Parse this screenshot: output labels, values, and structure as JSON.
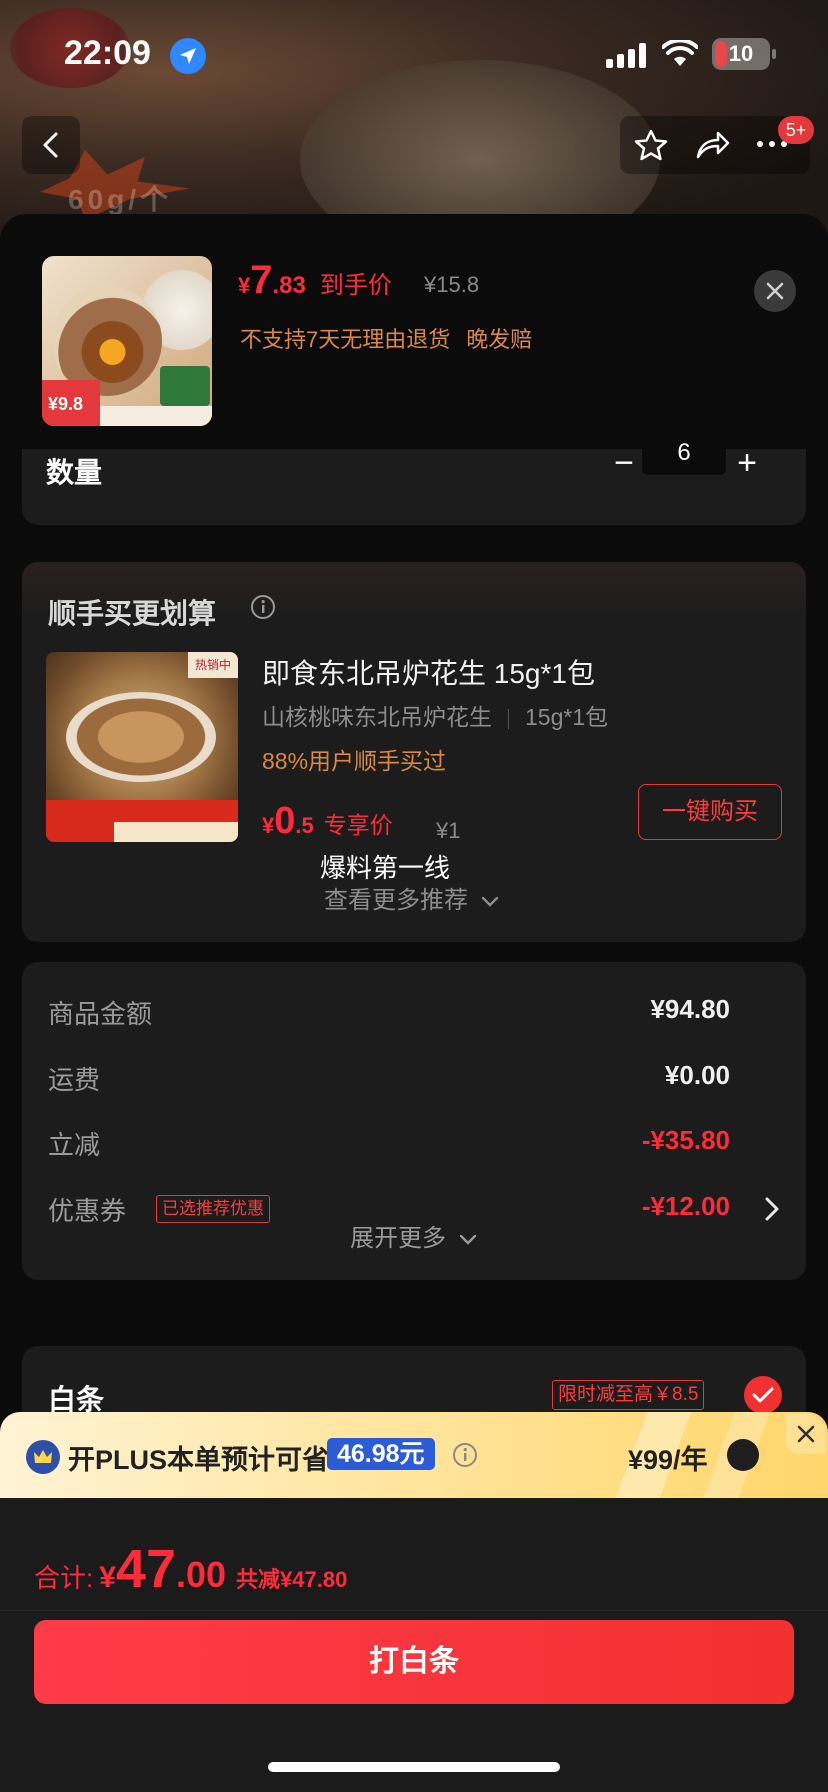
{
  "status_bar": {
    "time": "22:09",
    "battery": "10"
  },
  "nav": {
    "cart_badge": "5+"
  },
  "background": {
    "weight_text": "60g/个"
  },
  "product": {
    "price_symbol": "¥",
    "price_int": "7",
    "price_dec": ".83",
    "price_label": "到手价",
    "original_price": "¥15.8",
    "tags": [
      "不支持7天无理由退货",
      "晚发赔"
    ],
    "thumb_price": "¥9.8"
  },
  "quantity": {
    "label": "数量",
    "minus": "−",
    "value": "6",
    "plus": "+"
  },
  "recommend": {
    "title": "顺手买更划算",
    "item_name": "即食东北吊炉花生 15g*1包",
    "spec_flavor": "山核桃味东北吊炉花生",
    "spec_size": "15g*1包",
    "social_proof": "88%用户顺手买过",
    "price_symbol": "¥",
    "price_int": "0",
    "price_dec": ".5",
    "price_label": "专享价",
    "original_price": "¥1",
    "buy_button": "一键购买",
    "thumb_hot": "热销中",
    "overlay_text": "爆料第一线",
    "more_link": "查看更多推荐"
  },
  "summary": {
    "rows": [
      {
        "label": "商品金额",
        "value": "¥94.80"
      },
      {
        "label": "运费",
        "value": "¥0.00"
      },
      {
        "label": "立减",
        "value": "-¥35.80"
      },
      {
        "label": "优惠券",
        "value": "-¥12.00",
        "tag": "已选推荐优惠"
      }
    ],
    "expand": "展开更多"
  },
  "payment": {
    "label": "白条",
    "promo_tag": "限时减至高￥8.5"
  },
  "plus": {
    "text": "开PLUS本单预计可省",
    "save_amount": "46.98元",
    "price": "¥99/年"
  },
  "bottom": {
    "total_label": "合计:",
    "total_symbol": "¥",
    "total_int": "47",
    "total_dec": ".00",
    "total_saved": "共减¥47.80",
    "pay_button": "打白条"
  },
  "colors": {
    "accent_red": "#ff2b3b",
    "plus_blue": "#2b5bd7",
    "tag_orange": "#d98a3e"
  }
}
